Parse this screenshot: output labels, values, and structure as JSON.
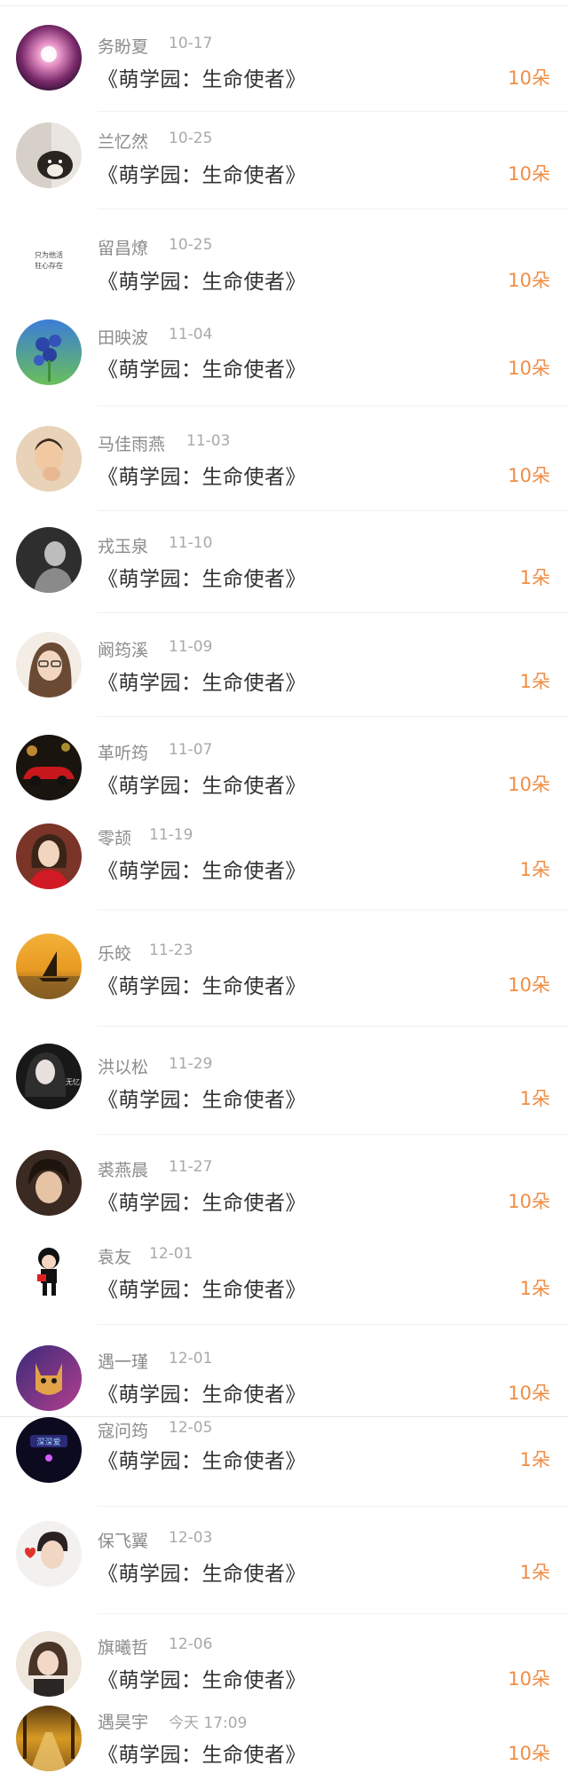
{
  "rows": [
    {
      "name": "务盼夏",
      "date": "10-17",
      "title": "《萌学园：生命使者》",
      "amount": "10朵",
      "avatar": "galaxy-avatar"
    },
    {
      "name": "兰忆然",
      "date": "10-25",
      "title": "《萌学园：生命使者》",
      "amount": "10朵",
      "avatar": "dog-avatar"
    },
    {
      "name": "留昌燎",
      "date": "10-25",
      "title": "《萌学园：生命使者》",
      "amount": "10朵",
      "avatar": "text-avatar",
      "avatar_text": "只为他活 狂心存在"
    },
    {
      "name": "田映波",
      "date": "11-04",
      "title": "《萌学园：生命使者》",
      "amount": "10朵",
      "avatar": "flower-avatar"
    },
    {
      "name": "马佳雨燕",
      "date": "11-03",
      "title": "《萌学园：生命使者》",
      "amount": "10朵",
      "avatar": "child-avatar"
    },
    {
      "name": "戎玉泉",
      "date": "11-10",
      "title": "《萌学园：生命使者》",
      "amount": "1朵",
      "avatar": "bw-person-avatar"
    },
    {
      "name": "阚筠溪",
      "date": "11-09",
      "title": "《萌学园：生命使者》",
      "amount": "1朵",
      "avatar": "girl-glasses-avatar"
    },
    {
      "name": "革听筠",
      "date": "11-07",
      "title": "《萌学园：生命使者》",
      "amount": "10朵",
      "avatar": "red-car-avatar"
    },
    {
      "name": "零颉",
      "date": "11-19",
      "title": "《萌学园：生命使者》",
      "amount": "1朵",
      "avatar": "girl-red-avatar"
    },
    {
      "name": "乐皎",
      "date": "11-23",
      "title": "《萌学园：生命使者》",
      "amount": "10朵",
      "avatar": "sunset-boat-avatar"
    },
    {
      "name": "洪以松",
      "date": "11-29",
      "title": "《萌学园：生命使者》",
      "amount": "1朵",
      "avatar": "dark-girl-avatar",
      "avatar_text": "无忆"
    },
    {
      "name": "裘燕晨",
      "date": "11-27",
      "title": "《萌学园：生命使者》",
      "amount": "10朵",
      "avatar": "boy-avatar"
    },
    {
      "name": "袁友",
      "date": "12-01",
      "title": "《萌学园：生命使者》",
      "amount": "1朵",
      "avatar": "cartoon-avatar"
    },
    {
      "name": "遇一瑾",
      "date": "12-01",
      "title": "《萌学园：生命使者》",
      "amount": "10朵",
      "avatar": "cat-avatar"
    },
    {
      "name": "寇问筠",
      "date": "12-05",
      "title": "《萌学园：生命使者》",
      "amount": "1朵",
      "avatar": "neon-avatar",
      "avatar_text": "深深爱"
    },
    {
      "name": "保飞翼",
      "date": "12-03",
      "title": "《萌学园：生命使者》",
      "amount": "1朵",
      "avatar": "heart-boy-avatar"
    },
    {
      "name": "旗曦哲",
      "date": "12-06",
      "title": "《萌学园：生命使者》",
      "amount": "10朵",
      "avatar": "girl-phone-avatar"
    },
    {
      "name": "遇昊宇",
      "date": "今天 17:09",
      "title": "《萌学园：生命使者》",
      "amount": "10朵",
      "avatar": "autumn-road-avatar"
    }
  ]
}
